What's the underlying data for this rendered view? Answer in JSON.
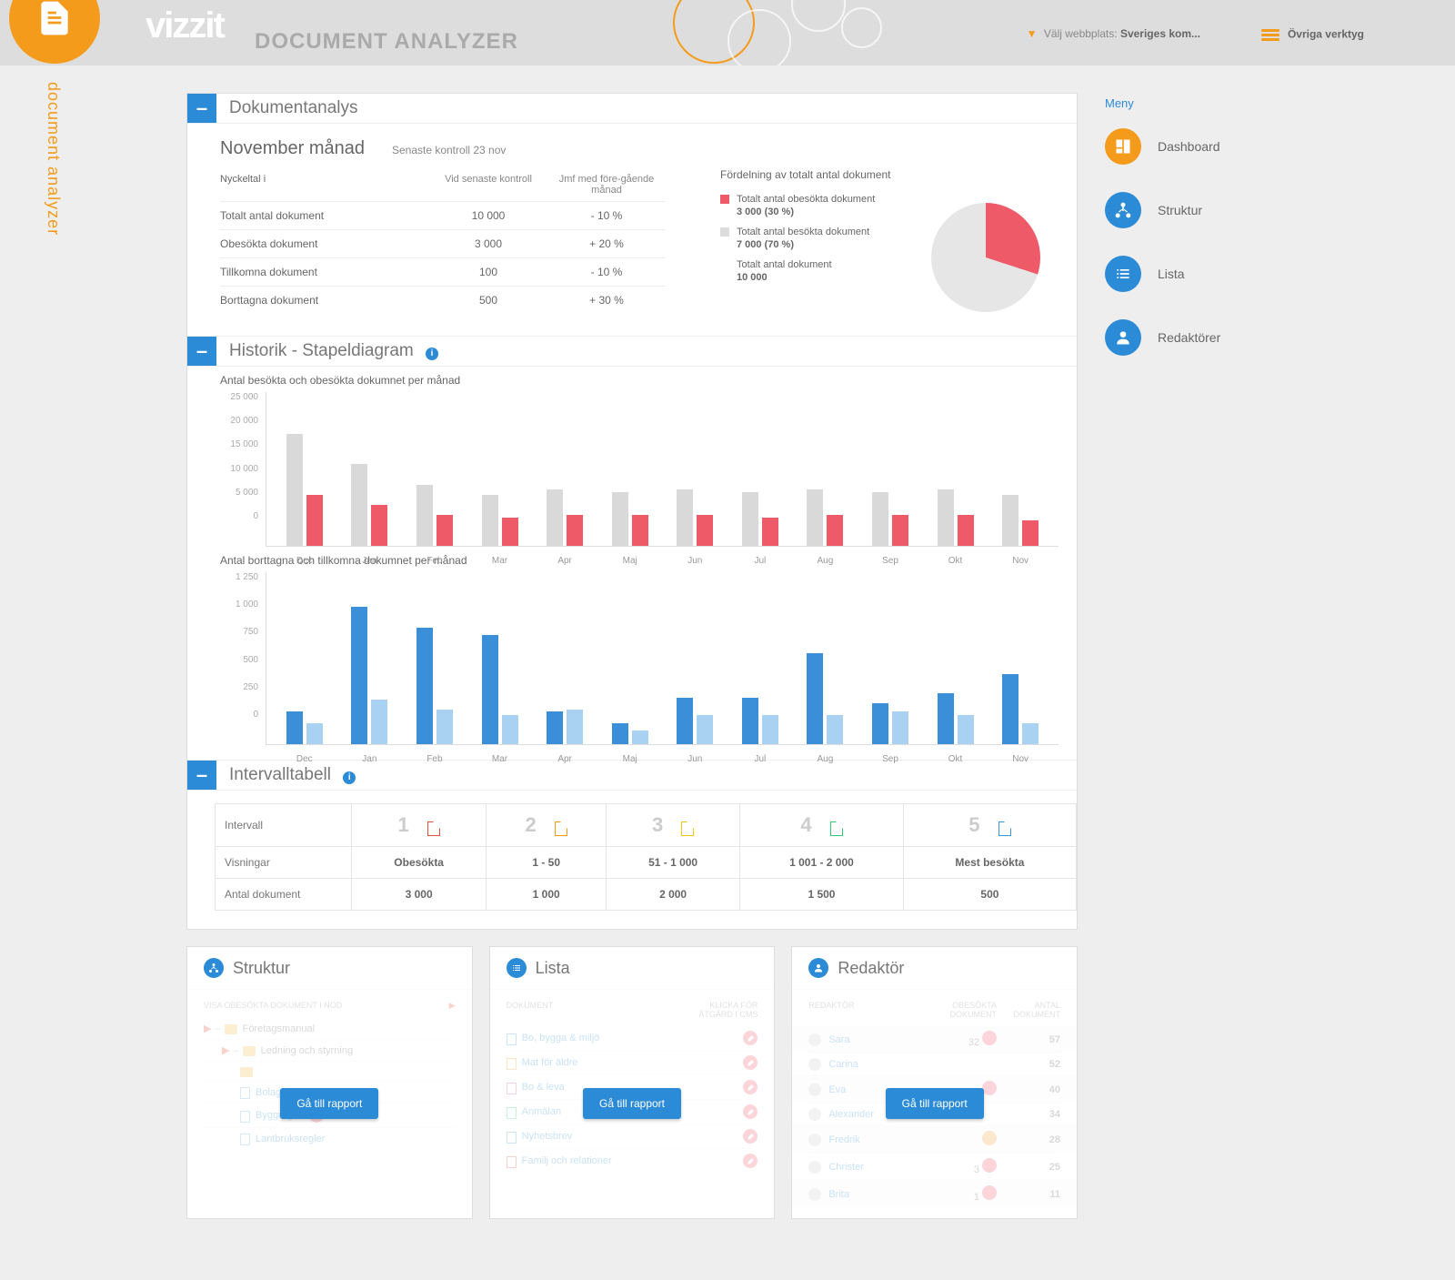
{
  "banner": {
    "logo": "vizzit",
    "subtitle": "DOCUMENT ANALYZER",
    "picker_label": "Välj webbplats:",
    "picker_value": "Sveriges kom...",
    "tools": "Övriga verktyg"
  },
  "side_badge": "document analyzer",
  "menu": {
    "title": "Meny",
    "items": [
      {
        "label": "Dashboard"
      },
      {
        "label": "Struktur"
      },
      {
        "label": "Lista"
      },
      {
        "label": "Redaktörer"
      }
    ]
  },
  "summary": {
    "section": "Dokumentanalys",
    "month": "November månad",
    "checked": "Senaste kontroll 23 nov",
    "col0": "Nyckeltal",
    "col1": "Vid senaste kontroll",
    "col2": "Jmf med före-gående månad",
    "rows": [
      {
        "k": "Totalt antal dokument",
        "v": "10 000",
        "d": "- 10 %"
      },
      {
        "k": "Obesökta dokument",
        "v": "3 000",
        "d": "+ 20 %"
      },
      {
        "k": "Tillkomna dokument",
        "v": "100",
        "d": "- 10 %"
      },
      {
        "k": "Borttagna dokument",
        "v": "500",
        "d": "+ 30 %"
      }
    ],
    "dist_title": "Fördelning av totalt antal dokument",
    "legend": [
      {
        "color": "#ef5a68",
        "t": "Totalt antal obesökta dokument",
        "v": "3 000 (30 %)"
      },
      {
        "color": "#dcdcdc",
        "t": "Totalt antal besökta dokument",
        "v": "7 000 (70 %)"
      },
      {
        "color": "#ffffff",
        "t": "Totalt antal dokument",
        "v": "10 000"
      }
    ]
  },
  "history": {
    "section": "Historik - Stapeldiagram",
    "t1": "Antal besökta och obesökta dokumnet per månad",
    "t2": "Antal borttagna och tillkomna dokumnet per månad"
  },
  "interval": {
    "section": "Intervalltabell",
    "hdr": [
      "Intervall",
      "1",
      "2",
      "3",
      "4",
      "5"
    ],
    "ic_colors": [
      "#e74c3c",
      "#f39c12",
      "#f1c40f",
      "#2ecc71",
      "#3498db"
    ],
    "rows": [
      [
        "Visningar",
        "Obesökta",
        "1 - 50",
        "51 - 1 000",
        "1 001 - 2 000",
        "Mest besökta"
      ],
      [
        "Antal dokument",
        "3 000",
        "1 000",
        "2 000",
        "1 500",
        "500"
      ]
    ]
  },
  "bottom": {
    "btn": "Gå till rapport",
    "struktur": {
      "title": "Struktur",
      "hdr": "VISA OBESÖKTA DOKUMENT I NOD",
      "items": [
        "Företagsmanual",
        "Ledning och styrning",
        "",
        "Bolagsregler",
        "Byggregler",
        "Lantbruksregler"
      ]
    },
    "lista": {
      "title": "Lista",
      "h1": "DOKUMENT",
      "h2": "KLICKA FÖR ÅTGÄRD I CMS",
      "items": [
        {
          "c": "#3498db",
          "t": "Bo, bygga & miljö"
        },
        {
          "c": "#f39c12",
          "t": "Mat för äldre"
        },
        {
          "c": "#e84c8b",
          "t": "Bo & leva"
        },
        {
          "c": "#2ecc71",
          "t": "Anmälan"
        },
        {
          "c": "#3498db",
          "t": "Nyhetsbrev"
        },
        {
          "c": "#e74c3c",
          "t": "Familj och relationer"
        }
      ]
    },
    "redaktor": {
      "title": "Redaktör",
      "h1": "REDAKTÖR",
      "h2": "OBESÖKTA DOKUMENT",
      "h3": "ANTAL DOKUMENT",
      "items": [
        {
          "n": "Sara",
          "o": "32",
          "oc": "red",
          "a": "57"
        },
        {
          "n": "Carina",
          "o": "",
          "oc": "",
          "a": "52"
        },
        {
          "n": "Eva",
          "o": "",
          "oc": "red",
          "a": "40"
        },
        {
          "n": "Alexander",
          "o": "",
          "oc": "",
          "a": "34"
        },
        {
          "n": "Fredrik",
          "o": "",
          "oc": "org",
          "a": "28"
        },
        {
          "n": "Christer",
          "o": "3",
          "oc": "red",
          "a": "25"
        },
        {
          "n": "Brita",
          "o": "1",
          "oc": "red",
          "a": "11"
        }
      ]
    }
  },
  "chart_data": [
    {
      "type": "bar",
      "title": "Antal besökta och obesökta dokumnet per månad",
      "ylim": [
        0,
        25000
      ],
      "yticks": [
        0,
        5000,
        10000,
        15000,
        20000,
        25000
      ],
      "categories": [
        "Dec",
        "Jan",
        "Feb",
        "Mar",
        "Apr",
        "Maj",
        "Jun",
        "Jul",
        "Aug",
        "Sep",
        "Okt",
        "Nov"
      ],
      "series": [
        {
          "name": "Besökta",
          "color": "#d9d9d9",
          "values": [
            22000,
            16000,
            12000,
            10000,
            11000,
            10500,
            11000,
            10500,
            11000,
            10500,
            11000,
            10000
          ]
        },
        {
          "name": "Obesökta",
          "color": "#ef5a68",
          "values": [
            10000,
            8000,
            6000,
            5500,
            6000,
            6000,
            6000,
            5500,
            6000,
            6000,
            6000,
            5000
          ]
        }
      ]
    },
    {
      "type": "bar",
      "title": "Antal borttagna och tillkomna dokumnet per månad",
      "ylim": [
        0,
        1250
      ],
      "yticks": [
        0,
        250,
        500,
        750,
        1000,
        1250
      ],
      "categories": [
        "Dec",
        "Jan",
        "Feb",
        "Mar",
        "Apr",
        "Maj",
        "Jun",
        "Jul",
        "Aug",
        "Sep",
        "Okt",
        "Nov"
      ],
      "series": [
        {
          "name": "Borttagna",
          "color": "#3a8fd8",
          "values": [
            280,
            1180,
            1000,
            940,
            280,
            180,
            400,
            400,
            780,
            350,
            440,
            600
          ]
        },
        {
          "name": "Tillkomna",
          "color": "#a9d2f2",
          "values": [
            180,
            380,
            300,
            250,
            300,
            120,
            250,
            250,
            250,
            280,
            250,
            180
          ]
        }
      ]
    }
  ]
}
